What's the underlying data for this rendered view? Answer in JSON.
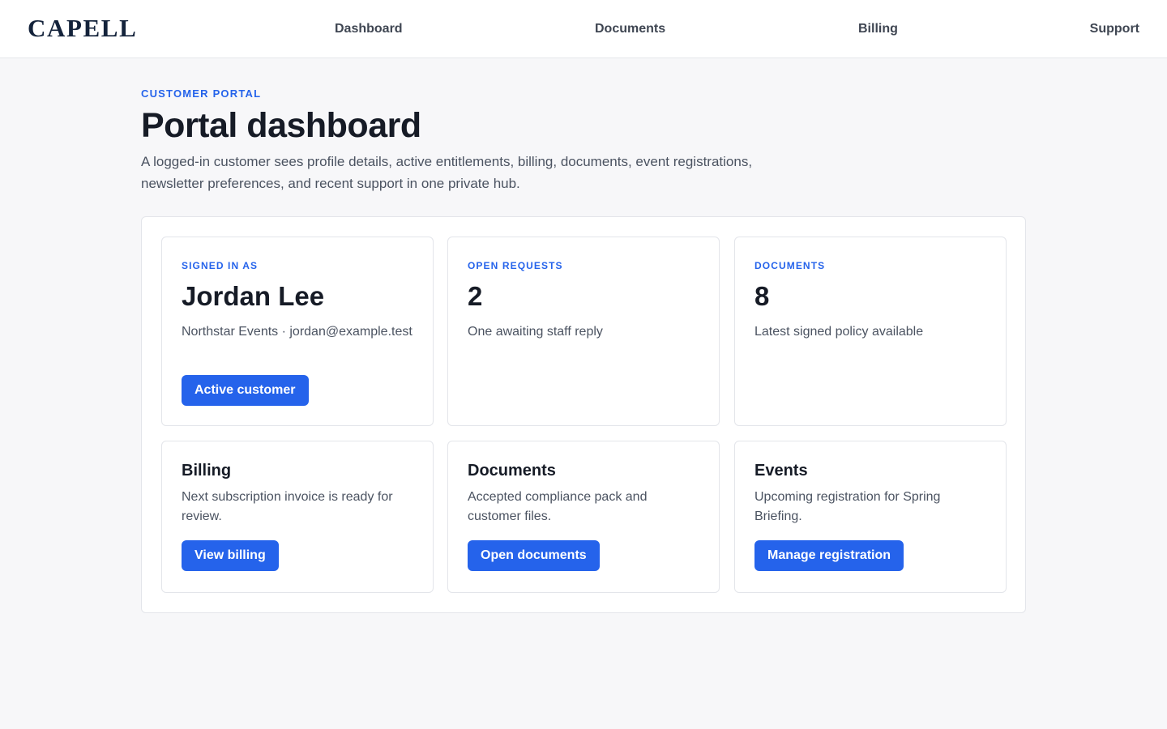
{
  "header": {
    "brand": "CAPELL",
    "nav": [
      {
        "label": "Dashboard"
      },
      {
        "label": "Documents"
      },
      {
        "label": "Billing"
      },
      {
        "label": "Support"
      }
    ]
  },
  "intro": {
    "eyebrow": "CUSTOMER PORTAL",
    "title": "Portal dashboard",
    "description": "A logged-in customer sees profile details, active entitlements, billing, documents, event registrations, newsletter preferences, and recent support in one private hub."
  },
  "stats": [
    {
      "label": "SIGNED IN AS",
      "value": "Jordan Lee",
      "detail": "Northstar Events · jordan@example.test",
      "badge": "Active customer"
    },
    {
      "label": "OPEN REQUESTS",
      "value": "2",
      "detail": "One awaiting staff reply"
    },
    {
      "label": "DOCUMENTS",
      "value": "8",
      "detail": "Latest signed policy available"
    }
  ],
  "sections": [
    {
      "title": "Billing",
      "text": "Next subscription invoice is ready for review.",
      "action": "View billing"
    },
    {
      "title": "Documents",
      "text": "Accepted compliance pack and customer files.",
      "action": "Open documents"
    },
    {
      "title": "Events",
      "text": "Upcoming registration for Spring Briefing.",
      "action": "Manage registration"
    }
  ],
  "colors": {
    "accent": "#2563eb",
    "brand": "#14233b",
    "background": "#f7f7f9",
    "text": "#161b26",
    "muted_text": "#4b5361"
  }
}
